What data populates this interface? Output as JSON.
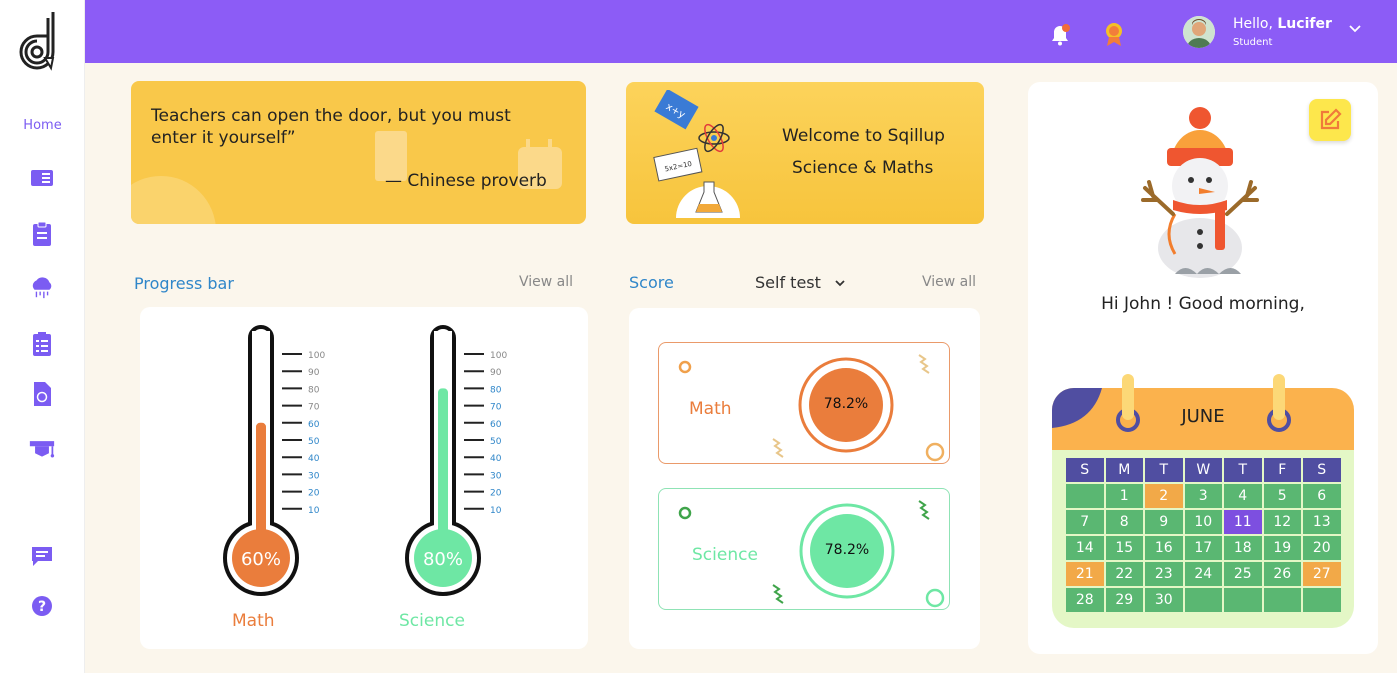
{
  "header": {
    "greeting_prefix": "Hello,",
    "user_name": "Lucifer",
    "role": "Student",
    "accent": "#8c5cf6"
  },
  "sidebar": {
    "home_label": "Home",
    "icons": [
      "book-icon",
      "clipboard-icon",
      "cloud-rain-icon",
      "checklist-icon",
      "document-icon",
      "graduation-cap-icon",
      "chat-icon",
      "help-icon"
    ]
  },
  "quote": {
    "text": "Teachers can open the door, but you must\n enter it yourself”",
    "author": "— Chinese proverb"
  },
  "welcome": {
    "line1": "Welcome to Sqillup",
    "line2": "Science & Maths"
  },
  "progress": {
    "title": "Progress bar",
    "view_all": "View all",
    "scale": [
      "100",
      "90",
      "80",
      "70",
      "60",
      "50",
      "40",
      "30",
      "20",
      "10"
    ],
    "items": [
      {
        "name": "Math",
        "value": 60,
        "label": "60%",
        "color": "#ea7d3c"
      },
      {
        "name": "Science",
        "value": 80,
        "label": "80%",
        "color": "#6ee7a4"
      }
    ]
  },
  "score": {
    "title": "Score",
    "select_value": "Self test",
    "view_all": "View all",
    "items": [
      {
        "name": "Math",
        "value": "78.2%",
        "color": "#ea7d3c"
      },
      {
        "name": "Science",
        "value": "78.2%",
        "color": "#6ee7a4"
      }
    ]
  },
  "greeting": {
    "text": "Hi John ! Good morning,"
  },
  "calendar": {
    "month": "JUNE",
    "day_names": [
      "S",
      "M",
      "T",
      "W",
      "T",
      "F",
      "S"
    ],
    "weeks": [
      [
        "",
        "1",
        "2",
        "3",
        "4",
        "5",
        "6"
      ],
      [
        "7",
        "8",
        "9",
        "10",
        "11",
        "12",
        "13"
      ],
      [
        "14",
        "15",
        "16",
        "17",
        "18",
        "19",
        "20"
      ],
      [
        "21",
        "22",
        "23",
        "24",
        "25",
        "26",
        "27"
      ],
      [
        "28",
        "29",
        "30",
        "",
        "",
        "",
        ""
      ]
    ],
    "highlight_orange": [
      "2",
      "21",
      "27"
    ],
    "highlight_purple": [
      "11"
    ]
  }
}
